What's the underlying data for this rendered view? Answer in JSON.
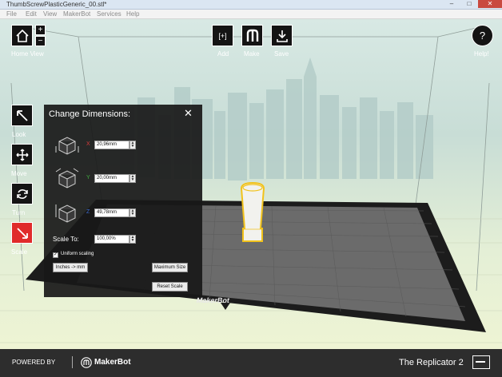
{
  "window": {
    "title": "ThumbScrewPlasticGeneric_00.stl*",
    "minimize": "–",
    "maximize": "□",
    "close": "✕"
  },
  "menu": [
    "File",
    "Edit",
    "View",
    "MakerBot",
    "Services",
    "Help"
  ],
  "toolbar": {
    "home_view": "Home View",
    "zoom_in": "+",
    "zoom_out": "−",
    "add": "Add",
    "add_glyph": "[+]",
    "make": "Make",
    "save": "Save",
    "help": "Help!",
    "help_glyph": "?"
  },
  "left_tools": [
    {
      "label": "Look",
      "icon": "look-arrow-icon"
    },
    {
      "label": "Move",
      "icon": "move-arrows-icon"
    },
    {
      "label": "Turn",
      "icon": "turn-rotate-icon"
    },
    {
      "label": "Scale",
      "icon": "scale-arrow-icon",
      "active": true
    }
  ],
  "dimensions_panel": {
    "title": "Change Dimensions:",
    "close": "✕",
    "x_label": "X",
    "x_value": "20,96mm",
    "y_label": "Y",
    "y_value": "20,00mm",
    "z_label": "Z",
    "z_value": "49,78mm",
    "scale_to_label": "Scale To:",
    "scale_value": "100,00%",
    "uniform_scaling_label": "Uniform scaling",
    "uniform_scaling_checked": true,
    "inches_button": "Inches -> mm",
    "maximum_size_button": "Maximum Size",
    "reset_scale_button": "Reset Scale",
    "spin_up": "▲",
    "spin_down": "▼"
  },
  "build_plate": {
    "brand": "MakerBot"
  },
  "bottom": {
    "powered_by": "POWERED BY",
    "brand": "MakerBot",
    "printer_name": "The Replicator 2"
  },
  "colors": {
    "scale_active": "#e02b2b",
    "axis_x": "#d93a3a",
    "axis_y": "#3fae3f",
    "axis_z": "#3d6fd8",
    "model_outline": "#f1c21b"
  }
}
